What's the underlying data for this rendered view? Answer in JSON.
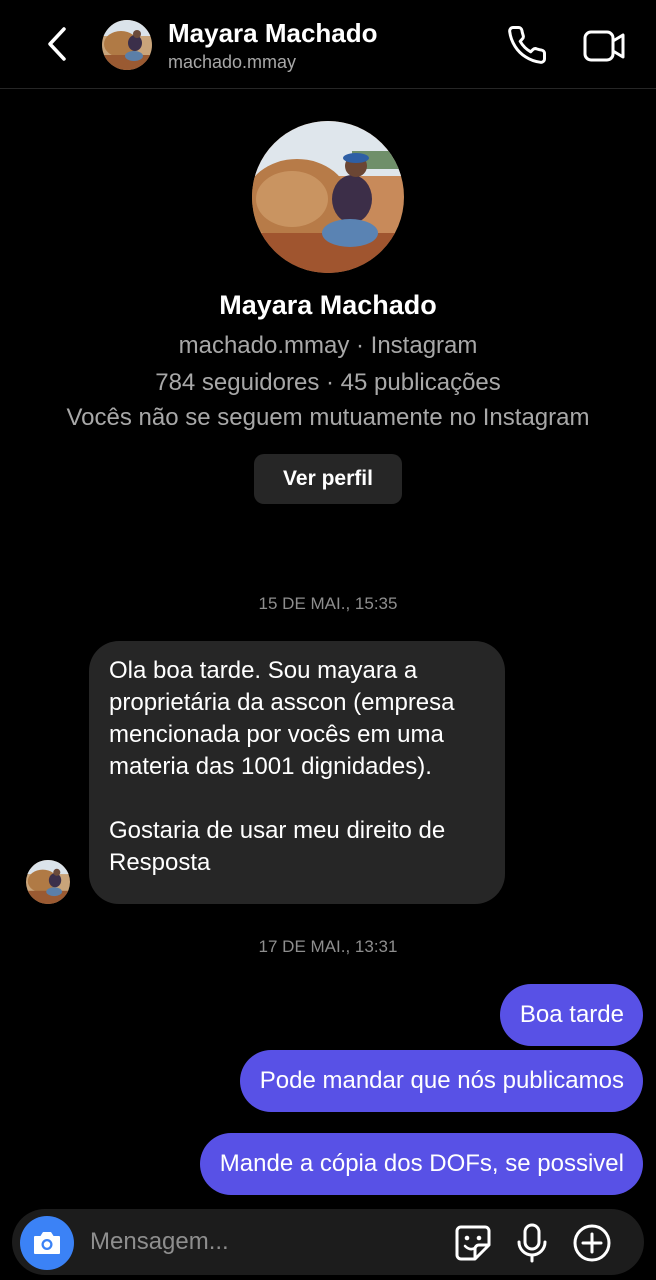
{
  "header": {
    "name": "Mayara Machado",
    "username": "machado.mmay"
  },
  "profile": {
    "name": "Mayara Machado",
    "username_line": "machado.mmay · Instagram",
    "stats_line": "784 seguidores · 45 publicações",
    "mutual_line": "Vocês não se seguem mutuamente no Instagram",
    "view_profile_label": "Ver perfil"
  },
  "conversation": {
    "timestamp_1": "15 DE MAI., 15:35",
    "incoming": {
      "paragraph_1": "Ola boa tarde. Sou mayara a proprietária da asscon (empresa mencionada por vocês em uma materia das 1001 dignidades).",
      "paragraph_2": "Gostaria de usar meu direito de Resposta"
    },
    "timestamp_2": "17 DE MAI., 13:31",
    "outgoing": [
      "Boa tarde",
      "Pode mandar que nós publicamos",
      "Mande a cópia dos DOFs, se possivel"
    ]
  },
  "composer": {
    "placeholder": "Mensagem..."
  },
  "colors": {
    "background": "#000000",
    "incoming_bubble": "#262626",
    "outgoing_bubble": "#5851e6",
    "camera_button": "#3b82f6",
    "secondary_text": "#a8a8a8"
  },
  "icons": [
    "back-arrow-icon",
    "phone-icon",
    "video-camera-icon",
    "camera-icon",
    "sticker-icon",
    "microphone-icon",
    "plus-circle-icon"
  ]
}
